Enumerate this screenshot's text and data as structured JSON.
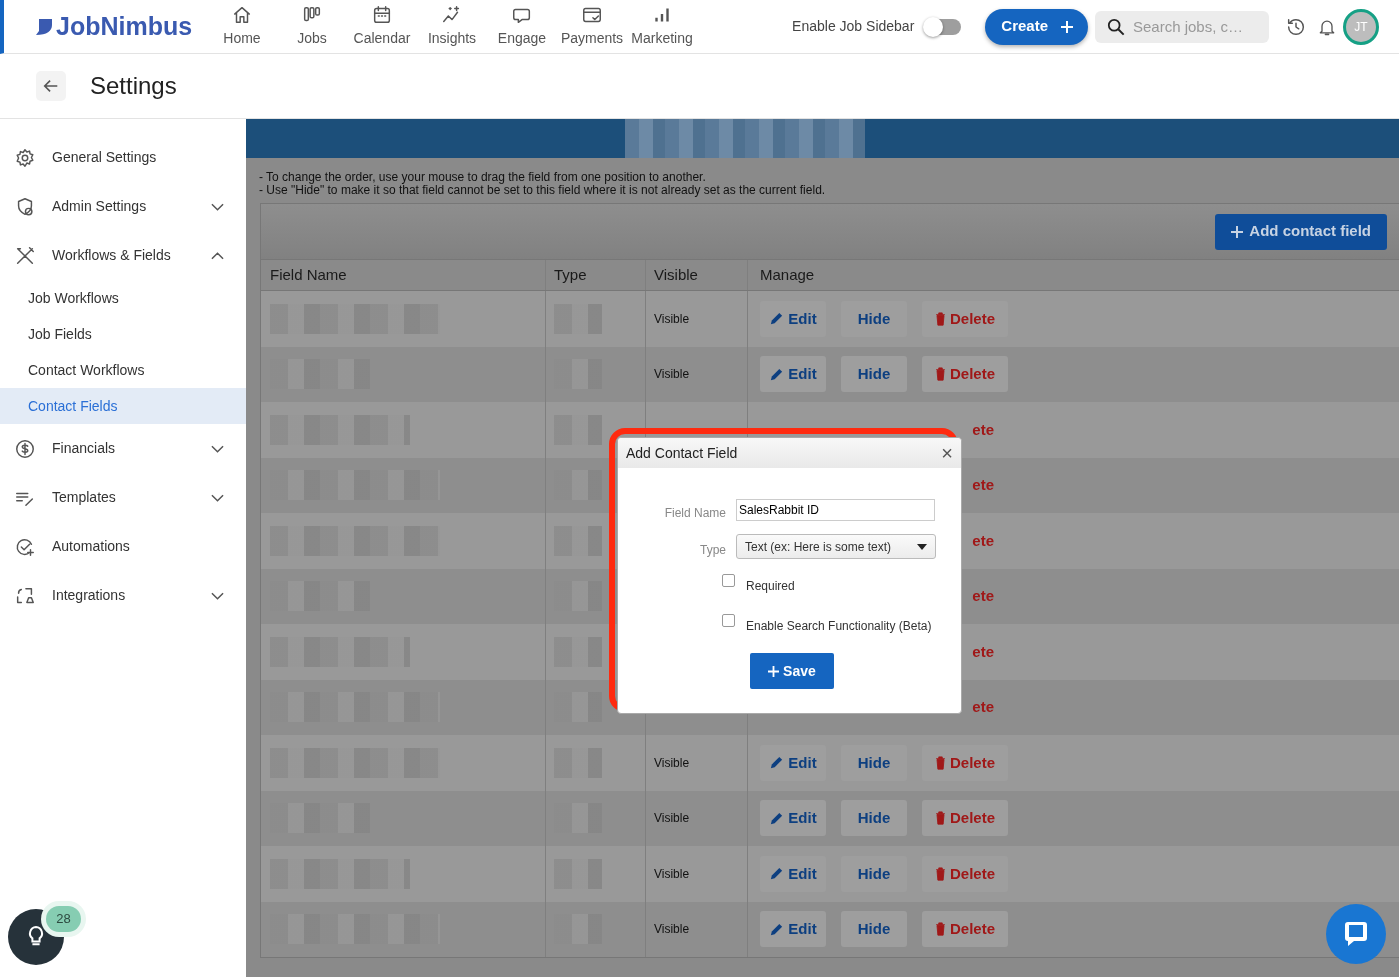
{
  "topbar": {
    "logo": "JobNimbus",
    "nav": [
      {
        "label": "Home"
      },
      {
        "label": "Jobs"
      },
      {
        "label": "Calendar"
      },
      {
        "label": "Insights"
      },
      {
        "label": "Engage"
      },
      {
        "label": "Payments"
      },
      {
        "label": "Marketing"
      }
    ],
    "sidebar_toggle": {
      "label": "Enable Job Sidebar",
      "on": false
    },
    "create_button": "Create",
    "search": {
      "placeholder": "Search jobs, c…"
    },
    "avatar": "JT"
  },
  "page": {
    "title": "Settings"
  },
  "sidebar": {
    "items": [
      {
        "label": "General Settings"
      },
      {
        "label": "Admin Settings",
        "expanded": false
      },
      {
        "label": "Workflows & Fields",
        "expanded": true,
        "children": [
          {
            "label": "Job Workflows",
            "selected": false
          },
          {
            "label": "Job Fields",
            "selected": false
          },
          {
            "label": "Contact Workflows",
            "selected": false
          },
          {
            "label": "Contact Fields",
            "selected": true
          }
        ]
      },
      {
        "label": "Financials",
        "expanded": false
      },
      {
        "label": "Templates",
        "expanded": false
      },
      {
        "label": "Automations"
      },
      {
        "label": "Integrations",
        "expanded": false
      }
    ]
  },
  "notes": [
    "- To change the order, use your mouse to drag the field from one position to another.",
    "- Use \"Hide\" to make it so that field cannot be set to this field where it is not already set as the current field."
  ],
  "add_button": "Add contact field",
  "table": {
    "columns": [
      "Field Name",
      "Type",
      "Visible",
      "Manage"
    ],
    "rows": [
      {
        "visible": "Visible",
        "actions": [
          {
            "kind": "edit",
            "label": "Edit"
          },
          {
            "kind": "hide",
            "label": "Hide"
          },
          {
            "kind": "delete",
            "label": "Delete"
          }
        ]
      },
      {
        "visible": "Visible",
        "actions": [
          {
            "kind": "edit",
            "label": "Edit"
          },
          {
            "kind": "hide",
            "label": "Hide"
          },
          {
            "kind": "delete",
            "label": "Delete"
          }
        ]
      },
      {
        "actions": [
          {
            "kind": "delete",
            "label": "ete",
            "clipped": true
          }
        ]
      },
      {
        "actions": [
          {
            "kind": "delete",
            "label": "ete",
            "clipped": true
          }
        ]
      },
      {
        "actions": [
          {
            "kind": "delete",
            "label": "ete",
            "clipped": true
          }
        ]
      },
      {
        "actions": [
          {
            "kind": "delete",
            "label": "ete",
            "clipped": true
          }
        ]
      },
      {
        "actions": [
          {
            "kind": "delete",
            "label": "ete",
            "clipped": true
          }
        ]
      },
      {
        "actions": [
          {
            "kind": "delete",
            "label": "ete",
            "clipped": true
          }
        ]
      },
      {
        "visible": "Visible",
        "actions": [
          {
            "kind": "edit",
            "label": "Edit"
          },
          {
            "kind": "hide",
            "label": "Hide"
          },
          {
            "kind": "delete",
            "label": "Delete"
          }
        ]
      },
      {
        "visible": "Visible",
        "actions": [
          {
            "kind": "edit",
            "label": "Edit"
          },
          {
            "kind": "hide",
            "label": "Hide"
          },
          {
            "kind": "delete",
            "label": "Delete"
          }
        ]
      },
      {
        "visible": "Visible",
        "actions": [
          {
            "kind": "edit",
            "label": "Edit"
          },
          {
            "kind": "hide",
            "label": "Hide"
          },
          {
            "kind": "delete",
            "label": "Delete"
          }
        ]
      },
      {
        "visible": "Visible",
        "actions": [
          {
            "kind": "edit",
            "label": "Edit"
          },
          {
            "kind": "hide",
            "label": "Hide"
          },
          {
            "kind": "delete",
            "label": "Delete"
          }
        ]
      }
    ]
  },
  "modal": {
    "title": "Add Contact Field",
    "close": "×",
    "field_name": {
      "label": "Field Name",
      "value": "SalesRabbit ID"
    },
    "type": {
      "label": "Type",
      "value": "Text (ex: Here is some text)"
    },
    "checkboxes": [
      {
        "label": "Required",
        "checked": false
      },
      {
        "label": "Enable Search Functionality (Beta)",
        "checked": false
      }
    ],
    "save_button": "Save"
  },
  "help": {
    "count": "28"
  }
}
